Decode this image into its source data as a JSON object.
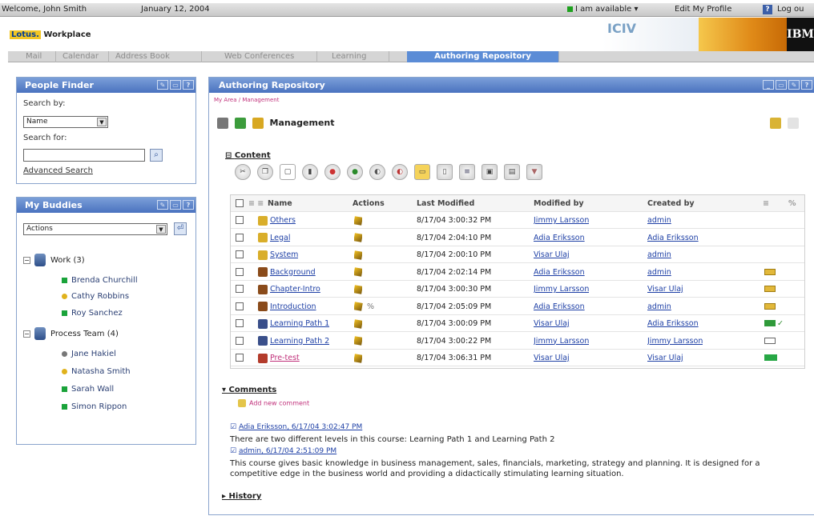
{
  "topbar": {
    "welcome": "Welcome, John Smith",
    "date": "January 12, 2004",
    "status": "I am available",
    "edit_profile": "Edit My Profile",
    "help": "?",
    "logout": "Log ou"
  },
  "header": {
    "logo_brand": "Lotus.",
    "logo_product": "Workplace",
    "ibm": "IBM",
    "decor_text": "ICIV"
  },
  "nav": {
    "tabs": [
      "Mail",
      "Calendar",
      "Address Book",
      "Web Conferences",
      "Learning",
      "Authoring Repository"
    ],
    "active": "Authoring Repository"
  },
  "people_finder": {
    "title": "People Finder",
    "search_by_label": "Search by:",
    "search_by_value": "Name",
    "search_for_label": "Search for:",
    "search_value": "",
    "advanced_link": "Advanced Search"
  },
  "buddies": {
    "title": "My Buddies",
    "actions_value": "Actions",
    "groups": [
      {
        "label": "Work (3)",
        "members": [
          {
            "name": "Brenda Churchill",
            "status": "green"
          },
          {
            "name": "Cathy Robbins",
            "status": "yellow"
          },
          {
            "name": "Roy Sanchez",
            "status": "green"
          }
        ]
      },
      {
        "label": "Process Team (4)",
        "members": [
          {
            "name": "Jane Hakiel",
            "status": "gray"
          },
          {
            "name": "Natasha Smith",
            "status": "yellow"
          },
          {
            "name": "Sarah Wall",
            "status": "green"
          },
          {
            "name": "Simon Rippon",
            "status": "green"
          }
        ]
      }
    ]
  },
  "repo": {
    "title": "Authoring Repository",
    "breadcrumb": "My Area / Management",
    "folder_title": "Management",
    "content_label": "Content",
    "comments_label": "Comments",
    "history_label": "History",
    "add_comment": "Add new comment",
    "columns": [
      "Name",
      "Actions",
      "Last Modified",
      "Modified by",
      "Created by"
    ],
    "rows": [
      {
        "name": "Others",
        "type": "folder",
        "modified": "8/17/04 3:00:32 PM",
        "modified_by": "Jimmy Larsson",
        "created_by": "admin",
        "status": ""
      },
      {
        "name": "Legal",
        "type": "folder",
        "modified": "8/17/04 2:04:10 PM",
        "modified_by": "Adia Eriksson",
        "created_by": "Adia Eriksson",
        "status": ""
      },
      {
        "name": "System",
        "type": "folder",
        "modified": "8/17/04 2:00:10 PM",
        "modified_by": "Visar Ulaj",
        "created_by": "admin",
        "status": ""
      },
      {
        "name": "Background",
        "type": "doc",
        "modified": "8/17/04 2:02:14 PM",
        "modified_by": "Adia Eriksson",
        "created_by": "admin",
        "status": "draft"
      },
      {
        "name": "Chapter-Intro",
        "type": "doc",
        "modified": "8/17/04 3:00:30 PM",
        "modified_by": "Jimmy Larsson",
        "created_by": "Visar Ulaj",
        "status": "draft"
      },
      {
        "name": "Introduction",
        "type": "doc",
        "modified": "8/17/04 2:05:09 PM",
        "modified_by": "Adia Eriksson",
        "created_by": "admin",
        "status": "draft"
      },
      {
        "name": "Learning Path 1",
        "type": "path",
        "modified": "8/17/04 3:00:09 PM",
        "modified_by": "Visar Ulaj",
        "created_by": "Adia Eriksson",
        "status": "approved"
      },
      {
        "name": "Learning Path 2",
        "type": "path",
        "modified": "8/17/04 3:00:22 PM",
        "modified_by": "Jimmy Larsson",
        "created_by": "Jimmy Larsson",
        "status": "empty"
      },
      {
        "name": "Pre-test",
        "type": "test",
        "modified": "8/17/04 3:06:31 PM",
        "modified_by": "Visar Ulaj",
        "created_by": "Visar Ulaj",
        "status": "published"
      }
    ],
    "comments": [
      {
        "author": "Adia Eriksson, 6/17/04 3:02:47 PM",
        "body": "There are two different levels in this course: Learning Path 1 and Learning Path 2"
      },
      {
        "author": "admin, 6/17/04 2:51:09 PM",
        "body": "This course gives basic knowledge in business management, sales, financials, marketing, strategy and planning. It is designed for a competitive edge in the business world and providing a didactically stimulating learning situation."
      }
    ]
  },
  "colors": {
    "panel_header": "#4a72bf",
    "active_tab": "#5b8cd6",
    "status_green": "#1aa33a",
    "status_yellow": "#e0b21c",
    "accent_pink": "#c0307a"
  }
}
